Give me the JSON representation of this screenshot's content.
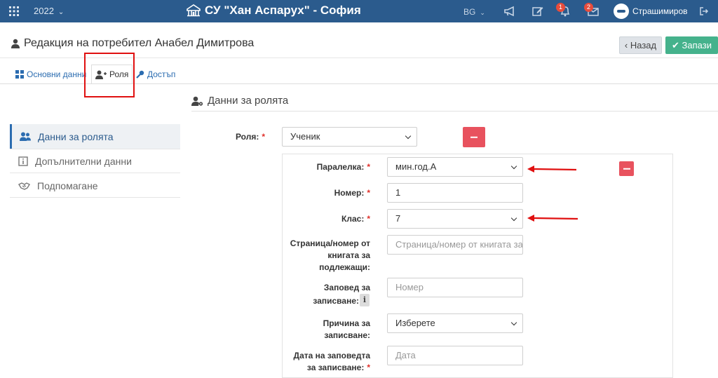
{
  "topbar": {
    "year": "2022",
    "school_name": "СУ \"Хан Аспарух\" - София",
    "language": "BG",
    "notifications_count": "1",
    "messages_count": "2",
    "username": "Страшимиров",
    "color": "#2b5b8d"
  },
  "header": {
    "title": "Редакция на потребител Анабел Димитрова",
    "back_label": "Назад",
    "save_label": "Запази",
    "save_color": "#45b28c"
  },
  "tabs": [
    {
      "label": "Основни данни",
      "icon": "grid-icon"
    },
    {
      "label": "Роля",
      "icon": "user-plus-icon"
    },
    {
      "label": "Достъп",
      "icon": "key-icon"
    }
  ],
  "sidebar": {
    "items": [
      {
        "label": "Данни за ролята",
        "icon": "users-icon"
      },
      {
        "label": "Допълнителни данни",
        "icon": "info-icon"
      },
      {
        "label": "Подпомагане",
        "icon": "handshake-icon"
      }
    ]
  },
  "section": {
    "title": "Данни за ролята"
  },
  "form": {
    "role_label": "Роля:",
    "role_value": "Ученик",
    "class_label": "Паралелка:",
    "class_value": "мин.год.А",
    "number_label": "Номер:",
    "number_value": "1",
    "grade_label": "Клас:",
    "grade_value": "7",
    "page_label_1": "Страница/номер от",
    "page_label_2": "книгата за",
    "page_label_3": "подлежащи:",
    "page_placeholder": "Страница/номер от книгата за подлежащи",
    "order_label_1": "Заповед за",
    "order_label_2": "записване:",
    "order_placeholder": "Номер",
    "reason_label_1": "Причина за",
    "reason_label_2": "записване:",
    "reason_value": "Изберете",
    "date_label_1": "Дата на заповедта",
    "date_label_2": "за записване:",
    "date_placeholder": "Дата",
    "required_mark": "*"
  },
  "colors": {
    "delete": "#e8525e",
    "annotation": "#e01010"
  }
}
